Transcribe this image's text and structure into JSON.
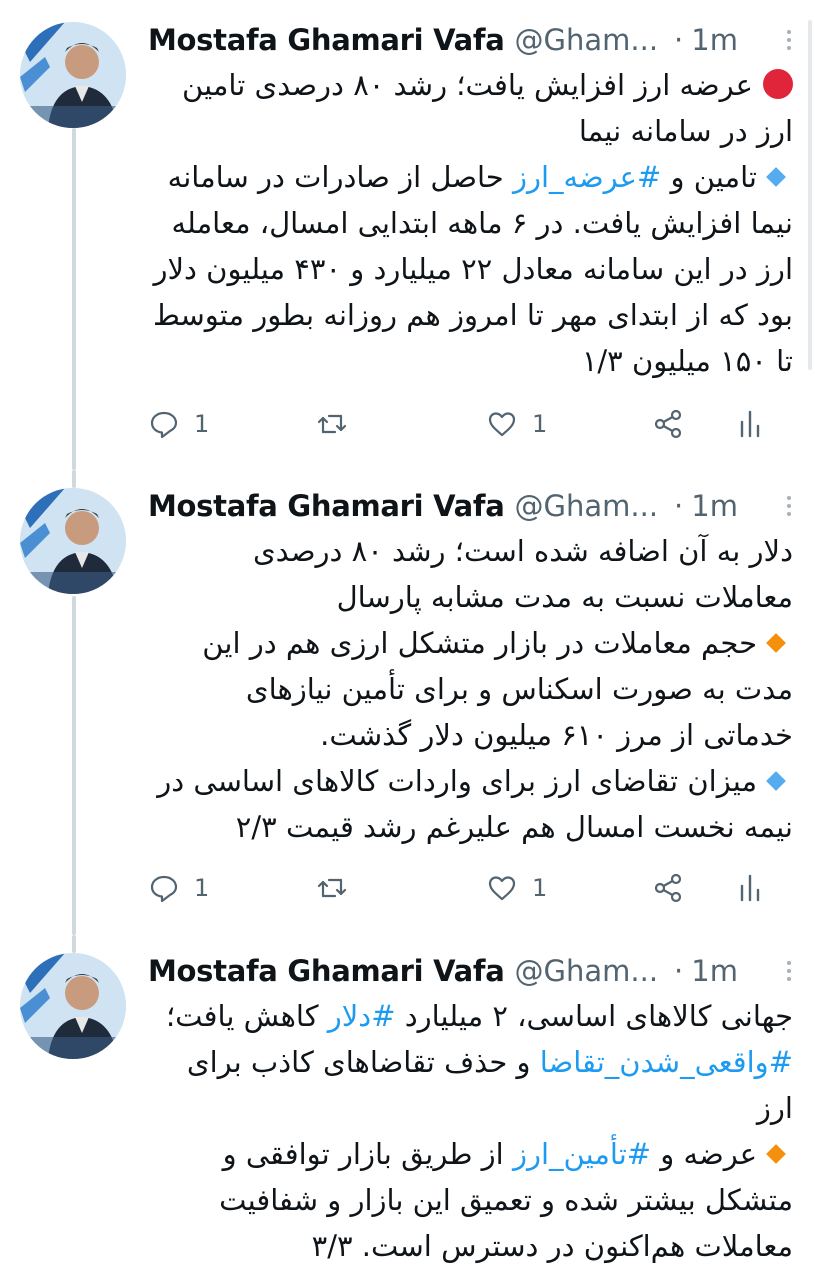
{
  "tweets": [
    {
      "name": "Mostafa Ghamari Vafa",
      "handle": "@Gham...",
      "dot": "·",
      "time": "1m",
      "line1": "عرضه ارز افزایش یافت؛ رشد ۸۰ درصدی تامین ارز در سامانه نیما",
      "p2_pre": "تامین و ",
      "p2_tag": "#عرضه_ارز",
      "p2_post": " حاصل از صادرات در سامانه نیما افزایش یافت. در ۶ ماهه ابتدایی امسال، معامله ارز در این سامانه معادل ۲۲ میلیارد و ۴۳۰ میلیون دلار بود که از ابتدای مهر تا امروز هم روزانه بطور متوسط تا ۱۵۰ میلیون ۱/۳",
      "replies": "1",
      "likes": "1"
    },
    {
      "name": "Mostafa Ghamari Vafa",
      "handle": "@Gham...",
      "dot": "·",
      "time": "1m",
      "p1": "دلار به آن اضافه شده است؛ رشد ۸۰ درصدی معاملات نسبت به مدت مشابه پارسال",
      "p2": "حجم معاملات در بازار متشکل ارزی هم در این مدت به صورت اسکناس و برای تأمین نیازهای خدماتی از مرز ۶۱۰ میلیون دلار گذشت.",
      "p3": "میزان تقاضای ارز برای واردات کالاهای اساسی در نیمه نخست امسال هم علیرغم رشد قیمت ۲/۳",
      "replies": "1",
      "likes": "1"
    },
    {
      "name": "Mostafa Ghamari Vafa",
      "handle": "@Gham...",
      "dot": "·",
      "time": "1m",
      "p1_pre": "جهانی کالاهای اساسی، ۲ میلیارد ",
      "p1_tag1": "#دلار",
      "p1_mid": " کاهش یافت؛ ",
      "p1_tag2": "#واقعی_شدن_تقاضا",
      "p1_post": " و حذف تقاضاهای کاذب برای ارز",
      "p2_pre": "عرضه و ",
      "p2_tag": "#تأمین_ارز",
      "p2_post": " از طریق بازار توافقی و متشکل بیشتر شده و تعمیق این بازار و شفافیت معاملات هم‌اکنون در دسترس است. ۳/۳"
    }
  ],
  "icons": {
    "reply": "reply-icon",
    "retweet": "retweet-icon",
    "like": "like-icon",
    "share": "share-icon",
    "analytics": "analytics-icon",
    "more": "more-icon"
  },
  "colors": {
    "hashtag": "#1d9bf0",
    "bullet_red": "#e0243a",
    "bullet_blue": "#55acee",
    "bullet_orange": "#f4900c"
  }
}
